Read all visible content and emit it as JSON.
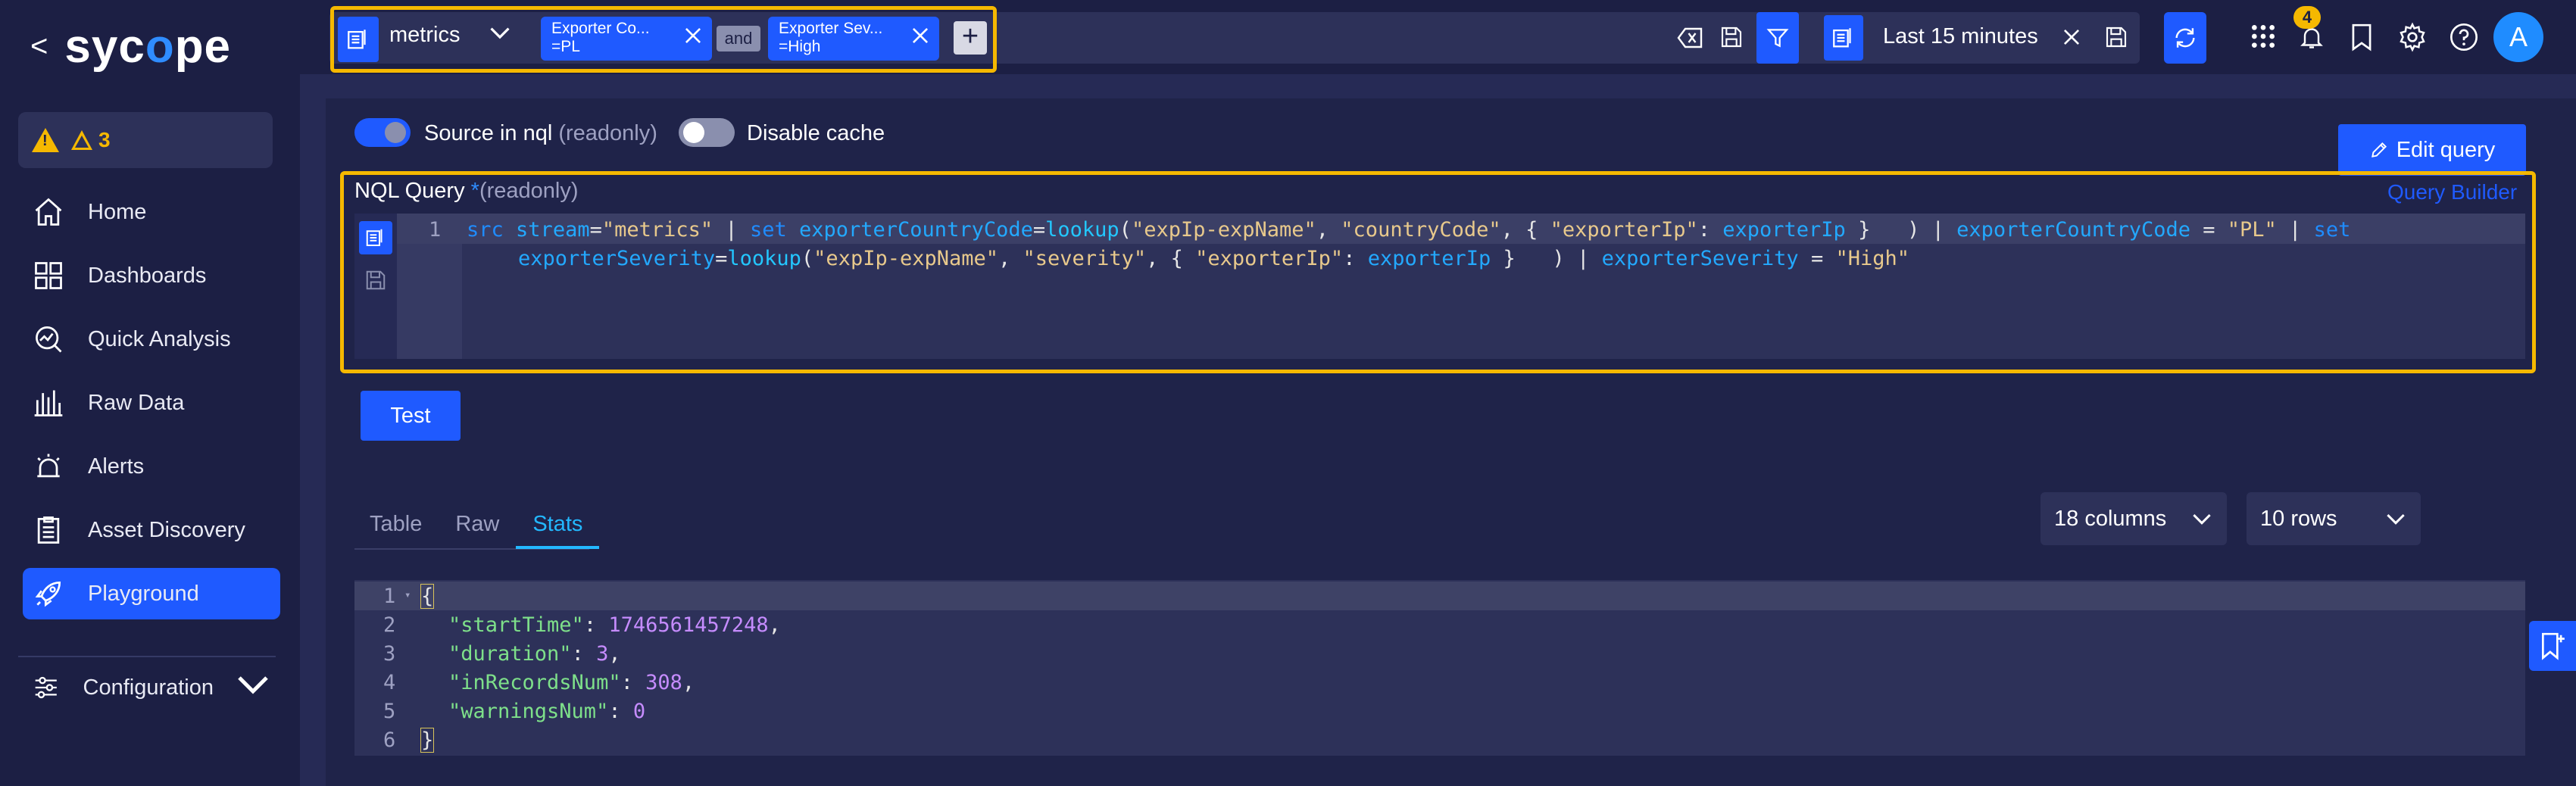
{
  "brand": {
    "name_prefix": "syc",
    "name_accent": "o",
    "name_suffix": "pe",
    "back_glyph": "<"
  },
  "alerts": {
    "count": "3"
  },
  "sidebar": {
    "items": [
      {
        "label": "Home",
        "icon": "home-icon"
      },
      {
        "label": "Dashboards",
        "icon": "dashboards-icon"
      },
      {
        "label": "Quick Analysis",
        "icon": "quick-analysis-icon"
      },
      {
        "label": "Raw Data",
        "icon": "raw-data-icon"
      },
      {
        "label": "Alerts",
        "icon": "alarm-icon"
      },
      {
        "label": "Asset Discovery",
        "icon": "clipboard-icon"
      },
      {
        "label": "Playground",
        "icon": "rocket-icon",
        "active": true
      }
    ],
    "configuration": {
      "label": "Configuration",
      "icon": "sliders-icon"
    }
  },
  "topbar": {
    "source": "metrics",
    "chips": [
      {
        "line1": "Exporter Co...",
        "line2": "=PL"
      },
      {
        "line1": "Exporter Sev...",
        "line2": "=High"
      }
    ],
    "and_label": "and",
    "plus_label": "+",
    "time_range": "Last 15 minutes",
    "notifications_count": "4",
    "avatar_initial": "A"
  },
  "options": {
    "source_in_nql_label": "Source in nql",
    "source_in_nql_suffix": "(readonly)",
    "disable_cache_label": "Disable cache",
    "source_in_nql_on": true,
    "disable_cache_on": false
  },
  "edit_query_label": "Edit query",
  "nql": {
    "title": "NQL Query",
    "star": "*",
    "readonly": "(readonly)",
    "builder_link": "Query Builder",
    "line_number": "1"
  },
  "test_label": "Test",
  "tabs": [
    {
      "label": "Table",
      "active": false
    },
    {
      "label": "Raw",
      "active": false
    },
    {
      "label": "Stats",
      "active": true
    }
  ],
  "columns_select": "18 columns",
  "rows_select": "10 rows",
  "result": {
    "line_numbers": [
      "1",
      "2",
      "3",
      "4",
      "5",
      "6"
    ],
    "open_brace": "{",
    "close_brace": "}",
    "entries": [
      {
        "key": "\"startTime\"",
        "value": "1746561457248",
        "comma": ","
      },
      {
        "key": "\"duration\"",
        "value": "3",
        "comma": ","
      },
      {
        "key": "\"inRecordsNum\"",
        "value": "308",
        "comma": ","
      },
      {
        "key": "\"warningsNum\"",
        "value": "0",
        "comma": ""
      }
    ]
  },
  "colors": {
    "accent": "#1f5aff",
    "highlight": "#f5b800",
    "background": "#262a55",
    "sidebar": "#1c1f44"
  }
}
